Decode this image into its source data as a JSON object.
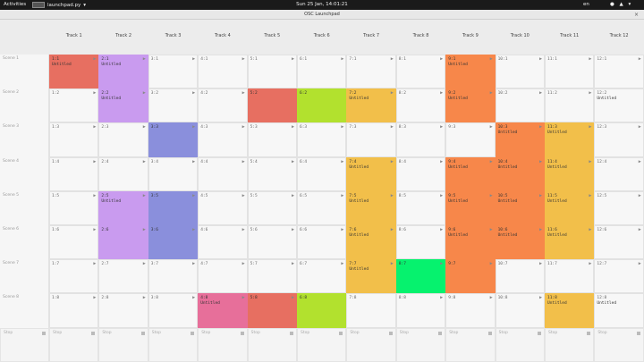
{
  "topbar": {
    "activities": "Activities",
    "app_name": "launchpad.py",
    "clock": "Sun 25 Jan, 14:01:21",
    "language": "en",
    "tray": "● ▲ ▾"
  },
  "window": {
    "title": "OSC Launchpad",
    "close_icon": "×"
  },
  "colors": {
    "red": "#e76f61",
    "purple": "#c99bef",
    "blue": "#8a8fdc",
    "orange": "#f7874a",
    "yellow": "#f2bf4a",
    "lime": "#b2e12e",
    "green": "#06f26e",
    "pink": "#e76f9a"
  },
  "tracks": [
    "Track 1",
    "Track 2",
    "Track 3",
    "Track 4",
    "Track 5",
    "Track 6",
    "Track 7",
    "Track 8",
    "Track 9",
    "Track 10",
    "Track 11",
    "Track 12"
  ],
  "scenes": [
    "Scene 1",
    "Scene 2",
    "Scene 3",
    "Scene 4",
    "Scene 5",
    "Scene 6",
    "Scene 7",
    "Scene 8"
  ],
  "stop_label": "Stop",
  "clip_name": "Untitled",
  "play_icon": "▶",
  "filled": {
    "1:1": "red",
    "2:1": "purple",
    "9:1": "orange",
    "2:2": "purple",
    "5:2": "red",
    "6:2": "lime",
    "7:2": "yellow",
    "9:2": "orange",
    "3:3": "blue",
    "10:3": "orange",
    "11:3": "yellow",
    "7:4": "yellow",
    "9:4": "orange",
    "10:4": "orange",
    "11:4": "yellow",
    "2:5": "purple",
    "3:5": "blue",
    "7:5": "yellow",
    "9:5": "orange",
    "10:5": "orange",
    "11:5": "yellow",
    "2:6": "purple",
    "3:6": "blue",
    "7:6": "yellow",
    "9:6": "orange",
    "10:6": "orange",
    "11:6": "yellow",
    "7:7": "yellow",
    "8:7": "green",
    "9:7": "orange",
    "4:8": "pink",
    "5:8": "red",
    "6:8": "lime",
    "11:8": "yellow"
  },
  "named": [
    "1:1",
    "2:1",
    "9:1",
    "2:2",
    "7:2",
    "9:2",
    "2:5",
    "7:4",
    "7:5",
    "7:6",
    "7:7",
    "10:3",
    "11:3",
    "11:4",
    "11:5",
    "11:6",
    "9:4",
    "9:5",
    "9:6",
    "10:4",
    "10:5",
    "10:6",
    "4:8",
    "12:2",
    "12:8",
    "11:8"
  ],
  "no_play": [
    "5:2",
    "6:2",
    "6:8",
    "7:8",
    "11:8",
    "12:8",
    "12:2"
  ]
}
